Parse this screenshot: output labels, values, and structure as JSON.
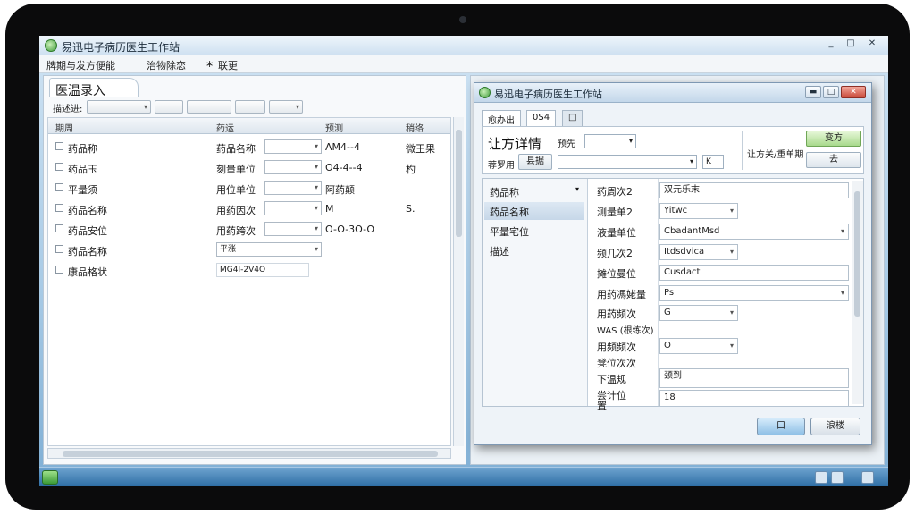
{
  "app": {
    "title": "易迅电子病历医生工作站",
    "menu": [
      "牌期与发方便能",
      "治物除恋",
      "∗",
      "联更"
    ],
    "window_controls": [
      "_",
      "□",
      "✕"
    ]
  },
  "left": {
    "tab": "医温录入",
    "filter_label": "描述进:",
    "headers": [
      "期周",
      "药运",
      "预测",
      "稍络"
    ],
    "rows": [
      {
        "col1": "药品称",
        "col2": "药品名称",
        "col3": "AM4--4",
        "col4": "微王果",
        "combo": true
      },
      {
        "col1": "药品玉",
        "col2": "刻量单位",
        "col3": "O4-4--4",
        "col4": "杓",
        "combo": true
      },
      {
        "col1": "平量须",
        "col2": "用位单位",
        "col3": "阿药颠",
        "col4": "",
        "combo": true
      },
      {
        "col1": "药品名称",
        "col2": "用药因次",
        "col3": "M",
        "col4": "S.",
        "combo": true
      },
      {
        "col1": "药品安位",
        "col2": "用药跨次",
        "col3": "O-O-3O-O",
        "col4": "",
        "combo": true
      },
      {
        "col1": "药品名称",
        "col2": "平涨",
        "col3": "",
        "col4": "",
        "combo": true
      },
      {
        "col1": "康品格状",
        "col2": "MG4I-2V4O",
        "col3": "",
        "col4": "",
        "combo": false
      }
    ]
  },
  "dialog": {
    "title": "易迅电子病历医生工作站",
    "tabs": [
      "愈办出",
      "0S4",
      "□"
    ],
    "big_label": "让方详情",
    "label_near": "预先",
    "row2_label": "荐罗用",
    "row2_button": "县据",
    "right_label": "让方关/重单期",
    "btn_green": "变方",
    "btn_small": "去",
    "input_mark": "K",
    "side_items": [
      "药品称",
      "药品名称",
      "平量宅位",
      "描述"
    ],
    "field_labels": [
      "药周次2",
      "测量单2",
      "液量单位",
      "频几次2",
      "摊位曼位",
      "用药馮姥量",
      "用药频次",
      "WAS (根练次)",
      "用频频次",
      "凳位次次",
      "下温规",
      "尝计位",
      "置"
    ],
    "field_values": [
      "双元乐末",
      "Yitwc",
      "CbadantMsd",
      "Itdsdvica",
      "Cusdact",
      "Ps",
      "G",
      "",
      "O",
      "",
      "颈到",
      "",
      "18"
    ],
    "ok": "口",
    "cancel": "浪楼"
  }
}
